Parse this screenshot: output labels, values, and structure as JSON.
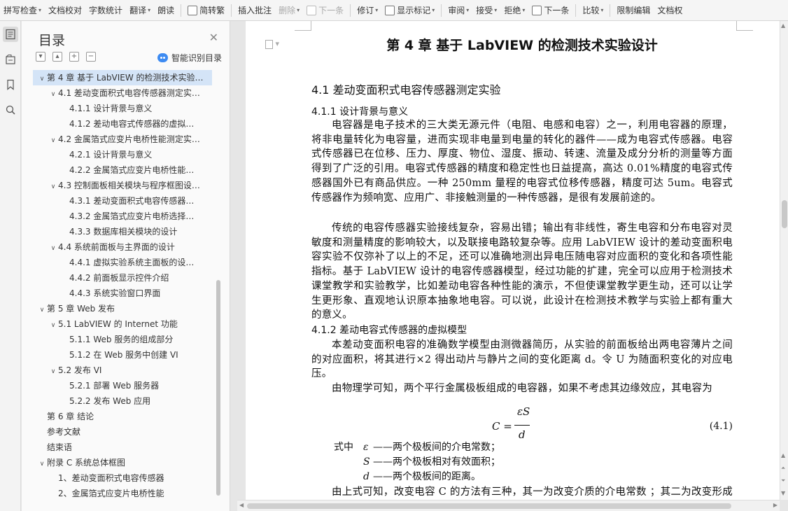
{
  "toolbar": {
    "items": [
      {
        "label": "拼写检查",
        "dropdown": true,
        "icon": "",
        "enabled": true
      },
      {
        "label": "文档校对",
        "dropdown": false,
        "icon": "",
        "enabled": true
      },
      {
        "label": "字数统计",
        "dropdown": false,
        "icon": "",
        "enabled": true
      },
      {
        "label": "翻译",
        "dropdown": true,
        "icon": "",
        "enabled": true
      },
      {
        "label": "朗读",
        "dropdown": false,
        "icon": "",
        "enabled": true
      },
      {
        "label": "简转繁",
        "dropdown": false,
        "icon": "convert-icon",
        "enabled": true
      },
      {
        "label": "插入批注",
        "dropdown": false,
        "icon": "",
        "enabled": true
      },
      {
        "label": "删除",
        "dropdown": true,
        "icon": "",
        "enabled": false
      },
      {
        "label": "下一条",
        "dropdown": false,
        "icon": "next-comment-icon",
        "enabled": false
      },
      {
        "label": "修订",
        "dropdown": true,
        "icon": "",
        "enabled": true
      },
      {
        "label": "显示标记",
        "dropdown": true,
        "icon": "markup-icon",
        "enabled": true
      },
      {
        "label": "审阅",
        "dropdown": true,
        "icon": "",
        "enabled": true
      },
      {
        "label": "接受",
        "dropdown": true,
        "icon": "",
        "enabled": true
      },
      {
        "label": "拒绝",
        "dropdown": true,
        "icon": "",
        "enabled": true
      },
      {
        "label": "下一条",
        "dropdown": false,
        "icon": "next-change-icon",
        "enabled": true
      },
      {
        "label": "比较",
        "dropdown": true,
        "icon": "",
        "enabled": true
      },
      {
        "label": "限制编辑",
        "dropdown": false,
        "icon": "",
        "enabled": true
      },
      {
        "label": "文档权",
        "dropdown": false,
        "icon": "",
        "enabled": true
      }
    ]
  },
  "rail": [
    "outline-icon",
    "bookmark-tree-icon",
    "bookmark-icon",
    "search-icon"
  ],
  "outline": {
    "title": "目录",
    "smart_label": "智能识别目录",
    "tools": [
      "collapse-all-icon",
      "expand-all-icon",
      "add-heading-icon",
      "remove-heading-icon"
    ],
    "items": [
      {
        "text": "第 4 章 基于 LabVIEW 的检测技术实验…",
        "level": 0,
        "toggle": "expanded",
        "selected": true
      },
      {
        "text": "4.1 差动变面积式电容传感器测定实…",
        "level": 1,
        "toggle": "expanded",
        "selected": false
      },
      {
        "text": "4.1.1 设计背景与意义",
        "level": 2,
        "toggle": "none",
        "selected": false
      },
      {
        "text": "4.1.2 差动电容式传感器的虚拟…",
        "level": 2,
        "toggle": "none",
        "selected": false
      },
      {
        "text": "4.2 金属箔式应变片电桥性能测定实…",
        "level": 1,
        "toggle": "expanded",
        "selected": false
      },
      {
        "text": "4.2.1 设计背景与意义",
        "level": 2,
        "toggle": "none",
        "selected": false
      },
      {
        "text": "4.2.2 金属箔式应变片电桥性能…",
        "level": 2,
        "toggle": "none",
        "selected": false
      },
      {
        "text": "4.3 控制面板相关模块与程序框图设…",
        "level": 1,
        "toggle": "expanded",
        "selected": false
      },
      {
        "text": "4.3.1 差动变面积式电容传感器…",
        "level": 2,
        "toggle": "none",
        "selected": false
      },
      {
        "text": "4.3.2 金属箔式应变片电桥选择…",
        "level": 2,
        "toggle": "none",
        "selected": false
      },
      {
        "text": "4.3.3 数据库相关模块的设计",
        "level": 2,
        "toggle": "none",
        "selected": false
      },
      {
        "text": "4.4 系统前面板与主界面的设计",
        "level": 1,
        "toggle": "expanded",
        "selected": false
      },
      {
        "text": "4.4.1 虚拟实验系统主面板的设…",
        "level": 2,
        "toggle": "none",
        "selected": false
      },
      {
        "text": "4.4.2 前面板显示控件介绍",
        "level": 2,
        "toggle": "none",
        "selected": false
      },
      {
        "text": "4.4.3 系统实验窗口界面",
        "level": 2,
        "toggle": "none",
        "selected": false
      },
      {
        "text": "第 5 章 Web 发布",
        "level": 0,
        "toggle": "expanded",
        "selected": false
      },
      {
        "text": "5.1 LabVIEW 的 Internet 功能",
        "level": 1,
        "toggle": "expanded",
        "selected": false
      },
      {
        "text": "5.1.1 Web 服务的组成部分",
        "level": 2,
        "toggle": "none",
        "selected": false
      },
      {
        "text": "5.1.2 在 Web 服务中创建 VI",
        "level": 2,
        "toggle": "none",
        "selected": false
      },
      {
        "text": "5.2 发布 VI",
        "level": 1,
        "toggle": "expanded",
        "selected": false
      },
      {
        "text": "5.2.1 部署 Web 服务器",
        "level": 2,
        "toggle": "none",
        "selected": false
      },
      {
        "text": "5.2.2 发布 Web 应用",
        "level": 2,
        "toggle": "none",
        "selected": false
      },
      {
        "text": "第 6 章 结论",
        "level": 0,
        "toggle": "none",
        "selected": false
      },
      {
        "text": "参考文献",
        "level": 0,
        "toggle": "none",
        "selected": false
      },
      {
        "text": "结束语",
        "level": 0,
        "toggle": "none",
        "selected": false
      },
      {
        "text": "附录 C 系统总体框图",
        "level": 0,
        "toggle": "expanded",
        "selected": false
      },
      {
        "text": "1、差动变面积式电容传感器",
        "level": 1,
        "toggle": "none",
        "selected": false
      },
      {
        "text": "2、金属箔式应变片电桥性能",
        "level": 1,
        "toggle": "none",
        "selected": false
      }
    ]
  },
  "document": {
    "chapter_title": "第 4 章  基于 LabVIEW 的检测技术实验设计",
    "section_title": "4.1  差动变面积式电容传感器测定实验",
    "sub1_title": "4.1.1  设计背景与意义",
    "para1": "电容器是电子技术的三大类无源元件（电阻、电感和电容）之一，利用电容器的原理，将非电量转化为电容量，进而实现非电量到电量的转化的器件——成为电容式传感器。电容式传感器已在位移、压力、厚度、物位、湿度、振动、转速、流量及成分分析的测量等方面得到了广泛的引用。电容式传感器的精度和稳定性也日益提高，高达 0.01%精度的电容式传感器国外已有商品供应。一种 250mm 量程的电容式位移传感器，精度可达 5um。电容式传感器作为频响宽、应用广、非接触测量的一种传感器，是很有发展前途的。",
    "para2": "传统的电容传感器实验接线复杂，容易出错；输出有非线性，寄生电容和分布电容对灵敏度和测量精度的影响较大，以及联接电路较复杂等。应用 LabVIEW 设计的差动变面积电容实验不仅弥补了以上的不足，还可以准确地测出异电压随电容对应面积的变化和各项性能指标。基于 LabVIEW 设计的电容传感器模型，经过功能的扩建，完全可以应用于检测技术课堂教学和实验教学，比如差动电容各种性能的演示，不但使课堂教学更生动，还可以让学生更形象、直观地认识原本抽象地电容。可以说，此设计在检测技术教学与实验上都有重大的意义。",
    "sub2_title": "4.1.2  差动电容式传感器的虚拟模型",
    "para3": "本差动变面积电容的准确数学模型由测微器简历，从实验的前面板给出两电容薄片之间的对应面积，将其进行×2 得出动片与静片之间的变化距离 d。令 U 为随面积变化的对应电压。",
    "para4": "由物理学可知，两个平行金属极板组成的电容器，如果不考虑其边缘效应，其电容为",
    "equation": {
      "lhs": "C =",
      "numerator": "εS",
      "denominator": "d",
      "number": "(4.1)"
    },
    "defs_lead": "式中",
    "defs": [
      {
        "symbol": "ε",
        "text": "——两个极板间的介电常数；"
      },
      {
        "symbol": "S",
        "text": "——两个极板相对有效面积；"
      },
      {
        "symbol": "d",
        "text": "——两个极板间的距离。"
      }
    ],
    "para5": "由上式可知，改变电容 C 的方法有三种，其一为改变介质的介电常数 ；其二为改变形成电容的有效面积；其三为改变两个极板间的距离。"
  }
}
